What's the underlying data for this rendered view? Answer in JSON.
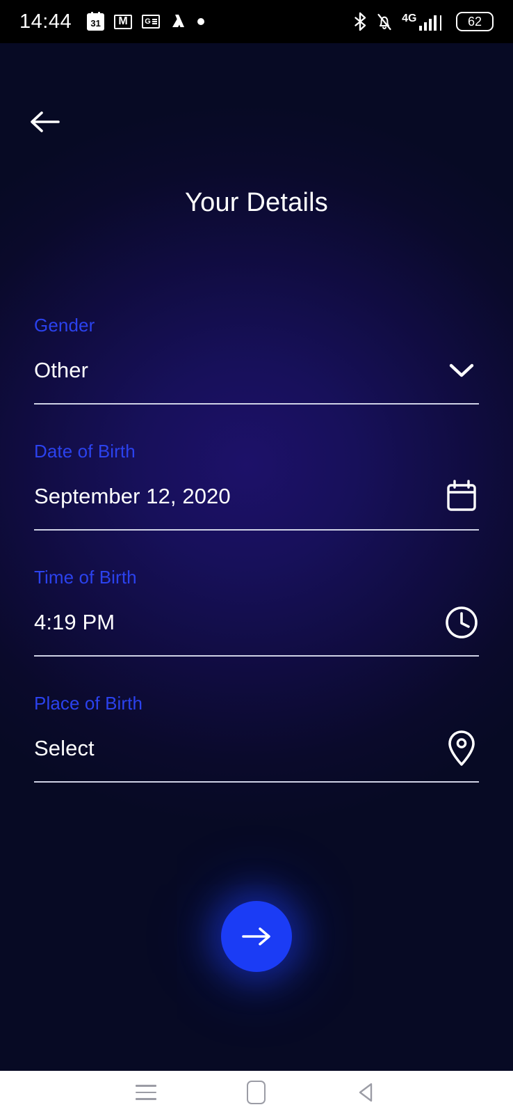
{
  "status_bar": {
    "clock": "14:44",
    "left_icons": [
      {
        "name": "calendar-icon",
        "label": "31"
      },
      {
        "name": "gmail-icon",
        "label": "M"
      },
      {
        "name": "google-news-icon",
        "label": "G"
      },
      {
        "name": "google-drive-icon",
        "label": ""
      },
      {
        "name": "notification-dot-icon",
        "label": ""
      }
    ],
    "right_icons": [
      {
        "name": "bluetooth-icon",
        "label": ""
      },
      {
        "name": "notifications-off-icon",
        "label": ""
      },
      {
        "name": "mobile-signal-icon",
        "label": "4G"
      }
    ],
    "network_label": "4G",
    "battery_percent": "62"
  },
  "header": {
    "back_label": "Back",
    "title": "Your Details"
  },
  "form": {
    "fields": [
      {
        "label": "Gender",
        "value": "Other",
        "icon": "chevron-down-icon",
        "field_key": "gender"
      },
      {
        "label": "Date of Birth",
        "value": "September 12, 2020",
        "icon": "calendar-icon",
        "field_key": "date-of-birth"
      },
      {
        "label": "Time of Birth",
        "value": "4:19 PM",
        "icon": "clock-icon",
        "field_key": "time-of-birth"
      },
      {
        "label": "Place of Birth",
        "value": "Select",
        "icon": "location-pin-icon",
        "field_key": "place-of-birth"
      }
    ]
  },
  "actions": {
    "next_label": "Next"
  },
  "nav_bar": {
    "recents_label": "Recents",
    "home_label": "Home",
    "back_label": "Back"
  },
  "colors": {
    "accent_blue": "#2b42ee",
    "fab_blue": "#1b3cf5",
    "text_white": "#ffffff",
    "underline": "#cfd2e6",
    "bg_dark": "#070a24",
    "bg_glow": "#1d1169",
    "nav_bar_bg": "#ffffff",
    "nav_icon": "#9b9ca5"
  }
}
